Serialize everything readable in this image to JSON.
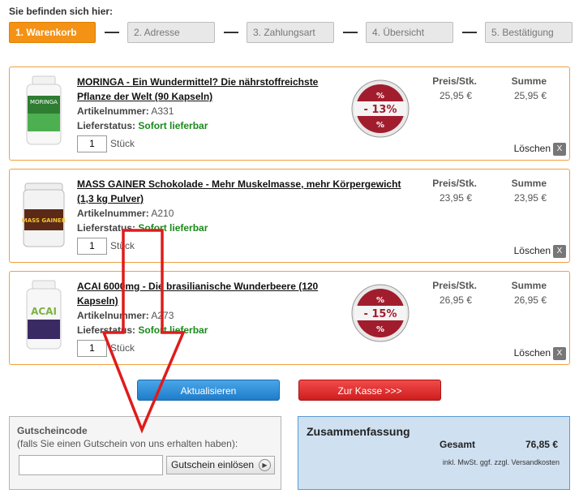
{
  "breadcrumb": {
    "title": "Sie befinden sich hier:",
    "steps": [
      {
        "label": "1. Warenkorb",
        "active": true
      },
      {
        "label": "2. Adresse",
        "active": false
      },
      {
        "label": "3. Zahlungsart",
        "active": false
      },
      {
        "label": "4. Übersicht",
        "active": false
      },
      {
        "label": "5. Bestätigung",
        "active": false
      }
    ]
  },
  "cart": {
    "price_header": "Preis/Stk.",
    "sum_header": "Summe",
    "artnr_label": "Artikelnummer:",
    "status_label": "Lieferstatus:",
    "unit_label": "Stück",
    "delete_label": "Löschen",
    "delete_icon": "X",
    "items": [
      {
        "title_line1": "MORINGA - Ein Wundermittel? Die nährstoffreichste",
        "title_line2": "Pflanze der Welt (90 Kapseln)",
        "article_number": "A331",
        "status": "Sofort lieferbar",
        "quantity": "1",
        "price": "25,95 €",
        "sum": "25,95 €",
        "discount": "- 13%",
        "badge_pct": "%",
        "image": "moringa-bottle-image",
        "image_text": "MORINGA"
      },
      {
        "title_line1": "MASS GAINER Schokolade - Mehr Muskelmasse, mehr Körpergewicht",
        "title_line2": "(1,3 kg Pulver)",
        "article_number": "A210",
        "status": "Sofort lieferbar",
        "quantity": "1",
        "price": "23,95 €",
        "sum": "23,95 €",
        "image": "mass-gainer-tub-image",
        "image_text": "MASS GAINER"
      },
      {
        "title_line1": "ACAI 6000mg - Die brasilianische Wunderbeere (120",
        "title_line2": "Kapseln)",
        "article_number": "A273",
        "status": "Sofort lieferbar",
        "quantity": "1",
        "price": "26,95 €",
        "sum": "26,95 €",
        "discount": "- 15%",
        "badge_pct": "%",
        "image": "acai-bottle-image",
        "image_text": "ACAI"
      }
    ]
  },
  "actions": {
    "update_label": "Aktualisieren",
    "checkout_label": "Zur Kasse >>>"
  },
  "voucher": {
    "heading": "Gutscheincode",
    "subtext": "(falls Sie einen Gutschein von uns erhalten haben):",
    "input_value": "",
    "button_label": "Gutschein einlösen",
    "button_icon": "play-circle-icon"
  },
  "summary": {
    "heading": "Zusammenfassung",
    "total_label": "Gesamt",
    "total_value": "76,85 €",
    "note": "inkl. MwSt. ggf. zzgl. Versandkosten"
  },
  "colors": {
    "accent_orange": "#f39215",
    "item_border": "#f0a040",
    "status_green": "#1a8a1a",
    "button_blue": "#1f7cc9",
    "button_red": "#cf1e1e",
    "summary_bg": "#cfe0f1",
    "annotation_red": "#e01b1b",
    "badge_red": "#a11d2e"
  }
}
